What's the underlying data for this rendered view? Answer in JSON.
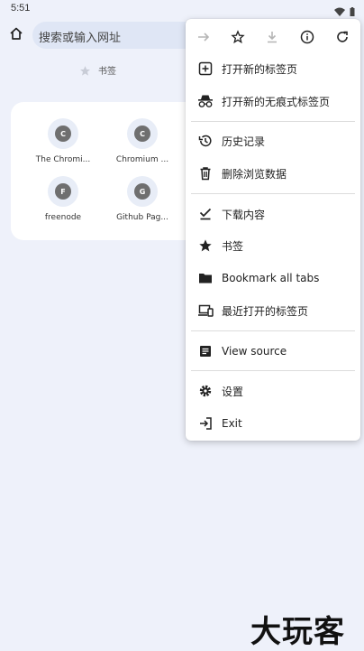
{
  "status_bar": {
    "time": "5:51"
  },
  "toolbar": {
    "omnibox_placeholder": "搜索或输入网址"
  },
  "bookmarks": {
    "label": "书签"
  },
  "tiles": [
    {
      "letter": "C",
      "label": "The Chromi..."
    },
    {
      "letter": "C",
      "label": "Chromium ..."
    },
    {
      "letter": "F",
      "label": "freenode"
    },
    {
      "letter": "G",
      "label": "Github Pag..."
    }
  ],
  "menu": {
    "top_icons": [
      "forward-arrow-icon",
      "star-outline-icon",
      "download-icon",
      "info-icon",
      "refresh-icon"
    ],
    "items": [
      {
        "label": "打开新的标签页",
        "icon": "new-tab-icon"
      },
      {
        "label": "打开新的无痕式标签页",
        "icon": "incognito-icon"
      },
      {
        "label": "历史记录",
        "icon": "history-icon"
      },
      {
        "label": "删除浏览数据",
        "icon": "trash-icon"
      },
      {
        "label": "下载内容",
        "icon": "downloads-check-icon"
      },
      {
        "label": "书签",
        "icon": "star-icon"
      },
      {
        "label": "Bookmark all tabs",
        "icon": "folder-icon"
      },
      {
        "label": "最近打开的标签页",
        "icon": "devices-icon"
      },
      {
        "label": "View source",
        "icon": "document-icon"
      },
      {
        "label": "设置",
        "icon": "gear-icon"
      },
      {
        "label": "Exit",
        "icon": "exit-icon"
      }
    ]
  },
  "watermark": "大玩客"
}
